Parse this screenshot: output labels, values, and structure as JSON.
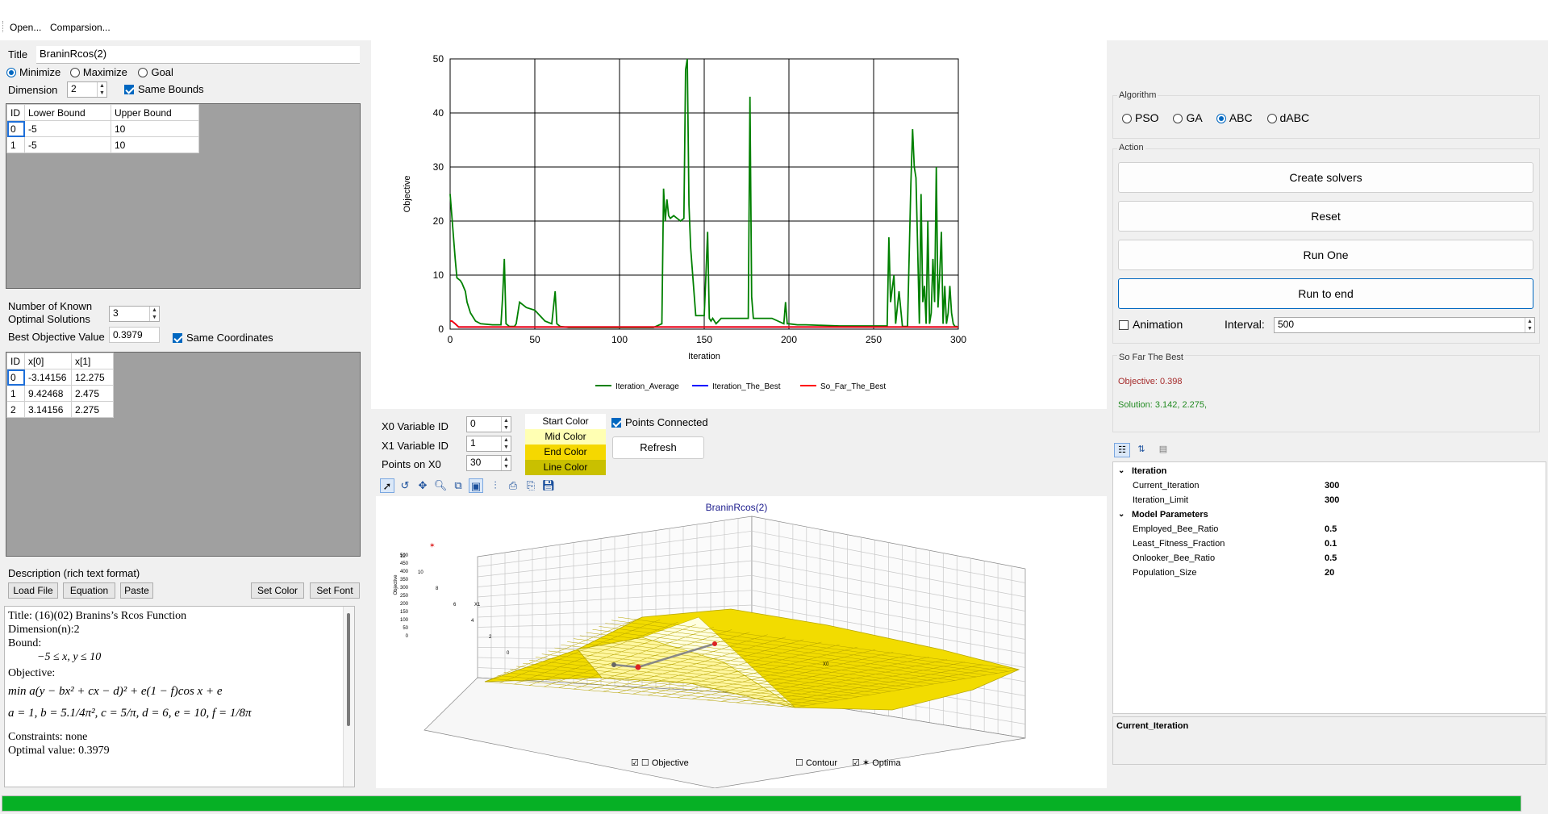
{
  "menu": {
    "open": "Open...",
    "comparison": "Comparsion..."
  },
  "problem": {
    "title_label": "Title",
    "title_value": "BraninRcos(2)",
    "goal_options": [
      "Minimize",
      "Maximize",
      "Goal"
    ],
    "selected_goal": "Minimize",
    "dimension_label": "Dimension",
    "dimension_value": "2",
    "same_bounds_label": "Same Bounds",
    "bounds_headers": [
      "ID",
      "Lower Bound",
      "Upper Bound"
    ],
    "bounds_rows": [
      [
        "0",
        "-5",
        "10"
      ],
      [
        "1",
        "-5",
        "10"
      ]
    ]
  },
  "known": {
    "num_label_1": "Number of Known",
    "num_label_2": "Optimal Solutions",
    "num_value": "3",
    "best_label": "Best Objective Value",
    "best_value": "0.3979",
    "same_coord_label": "Same Coordinates",
    "headers": [
      "ID",
      "x[0]",
      "x[1]"
    ],
    "rows": [
      [
        "0",
        "-3.14156",
        "12.275"
      ],
      [
        "1",
        "9.42468",
        "2.475"
      ],
      [
        "2",
        "3.14156",
        "2.275"
      ]
    ]
  },
  "description": {
    "label": "Description (rich text format)",
    "buttons": [
      "Load File",
      "Equation",
      "Paste",
      "Set Color",
      "Set Font"
    ],
    "lines": {
      "title": "Title: (16)(02) Branins’s Rcos Function",
      "dimension": "Dimension(n):2",
      "bound": "Bound:",
      "bound_eq": "−5 ≤ x, y ≤ 10",
      "objective": "Objective:",
      "objective_eq": "min  a(y − bx² + cx − d)² + e(1 − f)cos x + e",
      "params_eq": "a = 1, b = 5.1/4π², c = 5/π, d = 6, e = 10, f = 1/8π",
      "constraints": "Constraints: none",
      "optimal": "Optimal value: 0.3979"
    }
  },
  "chart_data": [
    {
      "type": "line",
      "xlabel": "Iteration",
      "ylabel": "Objective",
      "xlim": [
        0,
        300
      ],
      "ylim": [
        0,
        50
      ],
      "xticks": [
        0,
        50,
        100,
        150,
        200,
        250,
        300
      ],
      "yticks": [
        0,
        10,
        20,
        30,
        40,
        50
      ],
      "grid": true,
      "legend": "bottom",
      "series": [
        {
          "name": "Iteration_Average",
          "color": "#008000",
          "x": [
            0,
            1,
            3,
            4,
            6,
            7,
            9,
            10,
            12,
            15,
            18,
            25,
            30,
            31,
            32,
            33,
            35,
            38,
            39,
            41,
            45,
            50,
            53,
            56,
            60,
            61,
            62,
            63,
            65,
            70,
            80,
            100,
            120,
            125,
            126,
            127,
            128,
            129,
            130,
            132,
            134,
            136,
            138,
            139,
            140,
            141,
            142,
            145,
            150,
            151,
            152,
            153,
            154,
            155,
            157,
            160,
            170,
            176,
            177,
            178,
            179,
            180,
            185,
            190,
            197,
            198,
            199,
            200,
            205,
            210,
            230,
            250,
            258,
            259,
            260,
            262,
            263,
            265,
            267,
            270,
            272,
            273,
            274,
            275,
            276,
            277,
            278,
            279,
            280,
            281,
            282,
            283,
            284,
            285,
            286,
            287,
            288,
            289,
            290,
            291,
            292,
            293,
            294,
            295,
            296,
            297,
            298,
            299,
            300
          ],
          "y": [
            25,
            21,
            13,
            9.5,
            9,
            8.5,
            7,
            5,
            3,
            1.5,
            1,
            0.8,
            0.8,
            6,
            13,
            1,
            0.5,
            0.5,
            1,
            5,
            4,
            3.5,
            2.5,
            1.5,
            1,
            4,
            7,
            1,
            0.5,
            0.3,
            0.3,
            0.3,
            0.3,
            1,
            26,
            20,
            24,
            21,
            20.5,
            21,
            20.5,
            20,
            20.5,
            48,
            50,
            23,
            15,
            2.5,
            2.5,
            10,
            18,
            2,
            1.5,
            2,
            1,
            2,
            2,
            2,
            43,
            6,
            2,
            2,
            2,
            2,
            1,
            5,
            1,
            1,
            0.8,
            0.8,
            0.6,
            0.6,
            0.6,
            17,
            5,
            10,
            1,
            7,
            0.5,
            0.5,
            27,
            37,
            30,
            28,
            15,
            1,
            25,
            5,
            8,
            1,
            20,
            1,
            3,
            13,
            5,
            30,
            4,
            10,
            18,
            1,
            8,
            1,
            3,
            8,
            3,
            1,
            0.5,
            0.5,
            0.3
          ]
        },
        {
          "name": "Iteration_The_Best",
          "color": "#0000ff",
          "x": [
            0,
            1,
            3,
            5,
            300
          ],
          "y": [
            1.5,
            1.5,
            1.0,
            0.4,
            0.4
          ]
        },
        {
          "name": "So_Far_The_Best",
          "color": "#ff0000",
          "x": [
            0,
            1,
            3,
            5,
            300
          ],
          "y": [
            1.5,
            1.5,
            1.0,
            0.4,
            0.4
          ]
        }
      ]
    }
  ],
  "surface_controls": {
    "x0_label": "X0 Variable ID",
    "x0_value": "0",
    "x1_label": "X1 Variable ID",
    "x1_value": "1",
    "points_label": "Points on X0",
    "points_value": "30",
    "start_color": "Start Color",
    "mid_color": "Mid Color",
    "end_color": "End Color",
    "line_color": "Line Color",
    "points_connected": "Points Connected",
    "refresh": "Refresh",
    "colors": {
      "start": "#ffffff",
      "mid": "#ffffb3",
      "end": "#f5d800",
      "line": "#c9c000"
    }
  },
  "surface_plot": {
    "title": "BraninRcos(2)",
    "z_label": "Objective",
    "x_label": "X1",
    "y_label": "X0",
    "z_ticks": [
      "500",
      "450",
      "400",
      "350",
      "300",
      "250",
      "200",
      "150",
      "100",
      "50",
      "0"
    ],
    "x_ticks": [
      "12",
      "10",
      "8",
      "6",
      "4",
      "2",
      "0"
    ],
    "legend": [
      "Objective",
      "Contour",
      "Optima"
    ]
  },
  "algorithm": {
    "title": "Algorithm",
    "options": [
      "PSO",
      "GA",
      "ABC",
      "dABC"
    ],
    "selected": "ABC"
  },
  "action": {
    "title": "Action",
    "create": "Create solvers",
    "reset": "Reset",
    "run_one": "Run One",
    "run_end": "Run to end",
    "animation": "Animation",
    "interval_label": "Interval:",
    "interval_value": "500"
  },
  "best": {
    "title": "So Far The Best",
    "objective": "Objective: 0.398",
    "solution": "Solution: 3.142, 2.275,",
    "objective_color": "#a52a2a",
    "solution_color": "#228b22"
  },
  "properties": {
    "categories": [
      {
        "name": "Iteration",
        "rows": [
          [
            "Current_Iteration",
            "300"
          ],
          [
            "Iteration_Limit",
            "300"
          ]
        ]
      },
      {
        "name": "Model Parameters",
        "rows": [
          [
            "Employed_Bee_Ratio",
            "0.5"
          ],
          [
            "Least_Fitness_Fraction",
            "0.1"
          ],
          [
            "Onlooker_Bee_Ratio",
            "0.5"
          ],
          [
            "Population_Size",
            "20"
          ]
        ]
      }
    ],
    "description": "Current_Iteration"
  },
  "progress": {
    "fraction": 1.0,
    "color": "#06b025"
  }
}
